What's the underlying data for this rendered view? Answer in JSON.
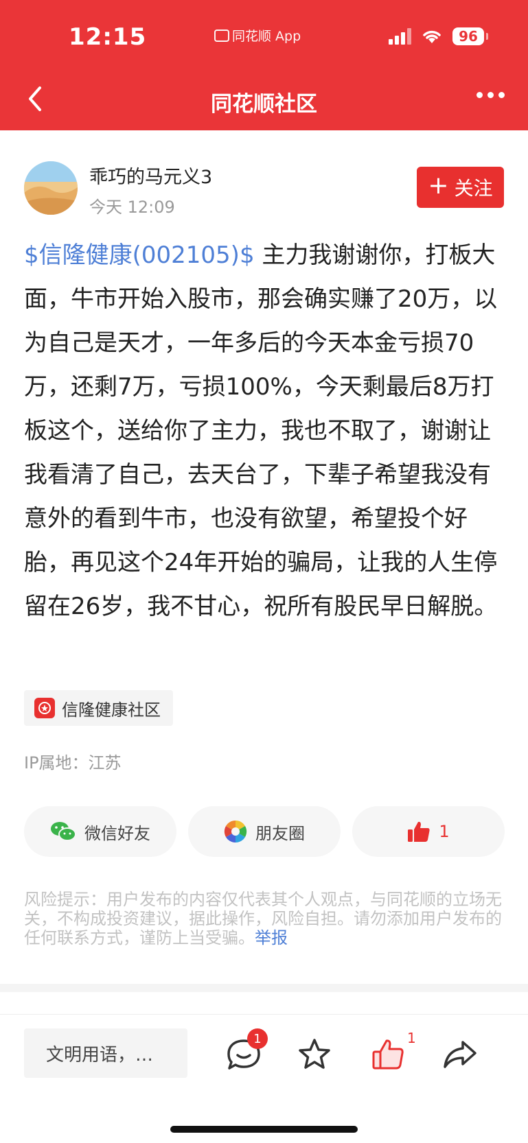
{
  "status_bar": {
    "time": "12:15",
    "app_name": "同花顺 App",
    "battery": "96"
  },
  "nav": {
    "title": "同花顺社区"
  },
  "post": {
    "username": "乖巧的马元义3",
    "time": "今天 12:09",
    "follow_label": "关注",
    "stock_link": "$信隆健康(002105)$",
    "body": " 主力我谢谢你，打板大面，牛市开始入股市，那会确实赚了20万，以为自己是天才，一年多后的今天本金亏损70万，还剩7万，亏损100%，今天剩最后8万打板这个，送给你了主力，我也不取了，谢谢让我看清了自己，去天台了，下辈子希望我没有意外的看到牛市，也没有欲望，希望投个好胎，再见这个24年开始的骗局，让我的人生停留在26岁，我不甘心，祝所有股民早日解脱。",
    "tag": "信隆健康社区",
    "ip": "IP属地：江苏"
  },
  "share": {
    "wechat": "微信好友",
    "moments": "朋友圈",
    "like_count": "1"
  },
  "risk": {
    "text": "风险提示：用户发布的内容仅代表其个人观点，与同花顺的立场无关，不构成投资建议，据此操作，风险自担。请勿添加用户发布的任何联系方式，谨防上当受骗。",
    "report": "举报"
  },
  "bottom_bar": {
    "comment_placeholder": "文明用语，…",
    "comment_badge": "1",
    "like_count": "1"
  },
  "colors": {
    "brand_red": "#ea3538",
    "link_blue": "#4e7fd6",
    "wechat_green": "#3ab34a"
  }
}
